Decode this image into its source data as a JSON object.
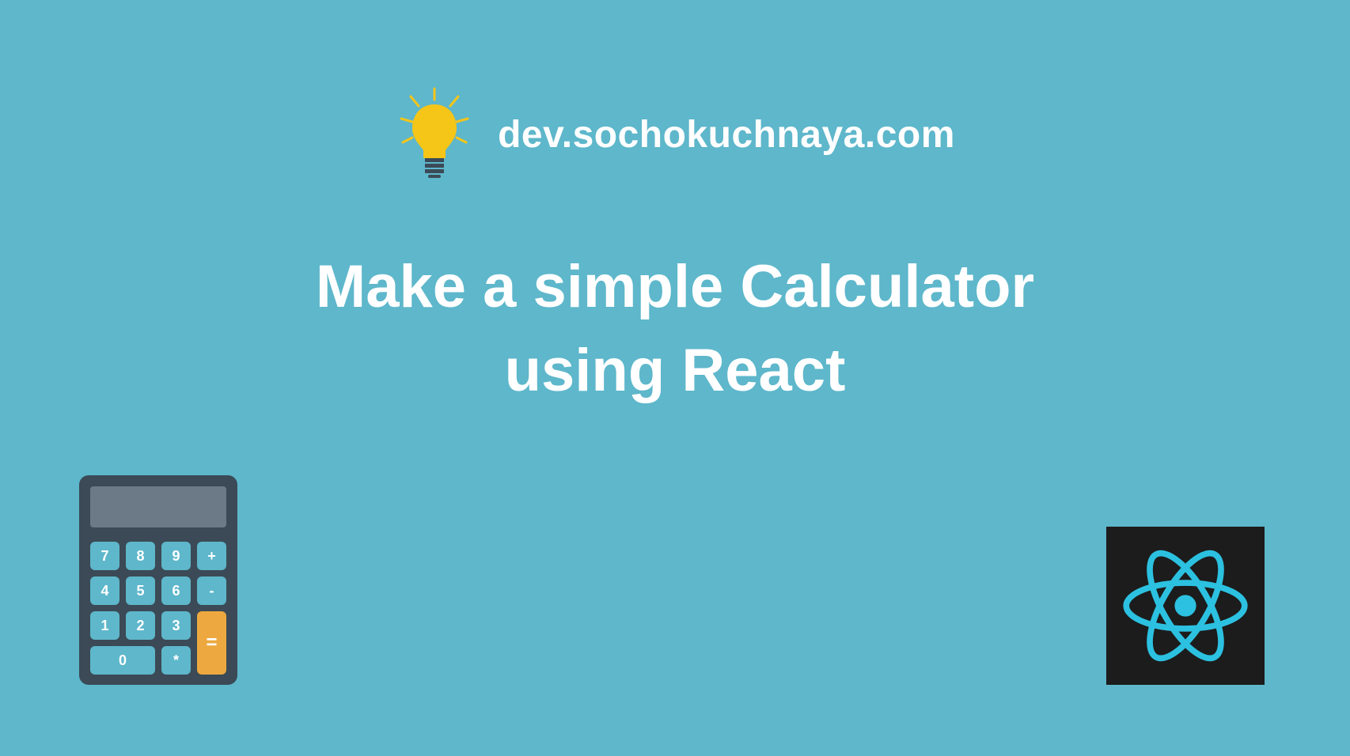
{
  "header": {
    "site_name": "dev.sochokuchnaya.com"
  },
  "title": {
    "line1": "Make a simple Calculator",
    "line2": "using React"
  },
  "calculator": {
    "buttons": [
      "7",
      "8",
      "9",
      "+",
      "4",
      "5",
      "6",
      "-",
      "1",
      "2",
      "3",
      "=",
      "0",
      "*"
    ]
  },
  "colors": {
    "background": "#5eb7cb",
    "text": "#ffffff",
    "calc_body": "#3b4a56",
    "calc_screen": "#6b7a86",
    "calc_btn": "#5eb7cb",
    "calc_equals": "#eda93f",
    "react_bg": "#1c1c1c",
    "react_cyan": "#2cc1e0",
    "bulb_yellow": "#f5c518"
  }
}
